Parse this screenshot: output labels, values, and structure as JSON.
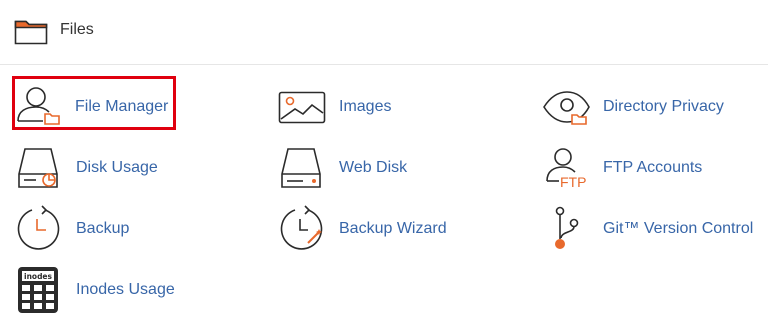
{
  "header": {
    "title": "Files",
    "icon": "folder-icon",
    "accent": "#e8692c"
  },
  "tools": {
    "file_manager": {
      "label": "File Manager",
      "icon": "user-folder-icon",
      "highlighted": true
    },
    "images": {
      "label": "Images",
      "icon": "image-icon"
    },
    "directory_privacy": {
      "label": "Directory Privacy",
      "icon": "eye-folder-icon"
    },
    "disk_usage": {
      "label": "Disk Usage",
      "icon": "disk-chart-icon"
    },
    "web_disk": {
      "label": "Web Disk",
      "icon": "hard-drive-icon"
    },
    "ftp_accounts": {
      "label": "FTP Accounts",
      "icon": "ftp-user-icon",
      "icon_text": "FTP"
    },
    "backup": {
      "label": "Backup",
      "icon": "clock-backup-icon"
    },
    "backup_wizard": {
      "label": "Backup Wizard",
      "icon": "clock-wand-icon"
    },
    "git_version_control": {
      "label": "Git™ Version Control",
      "icon": "git-branch-icon"
    },
    "inodes_usage": {
      "label": "Inodes Usage",
      "icon": "calculator-icon",
      "icon_text": "inodes"
    }
  },
  "colors": {
    "link": "#3866a8",
    "icon_stroke": "#2b2b2b",
    "accent": "#e8692c",
    "highlight_border": "#e0000f"
  }
}
